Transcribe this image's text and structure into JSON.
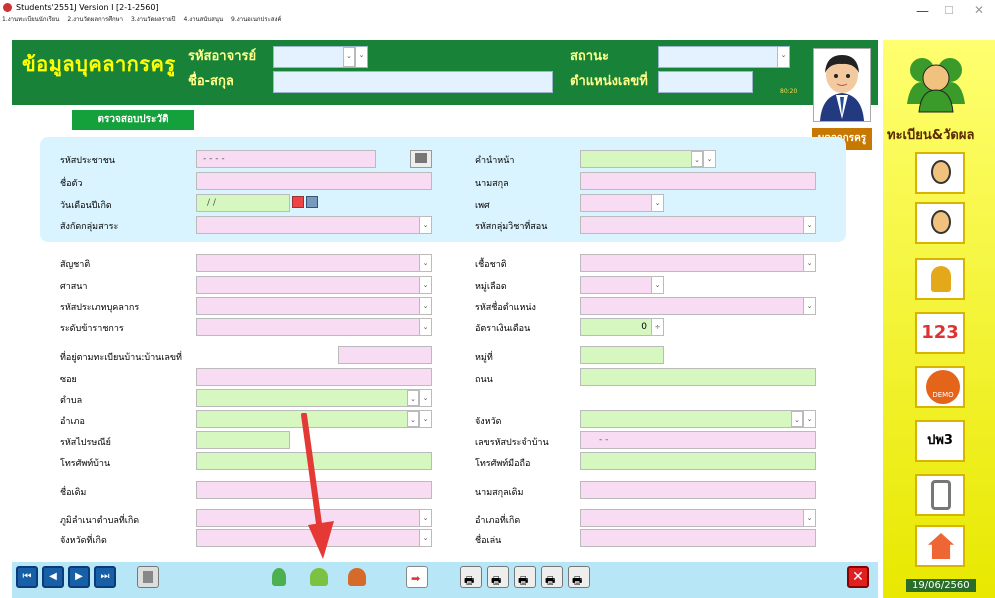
{
  "window": {
    "title": "Students'2551J Version I [2-1-2560]",
    "menu": [
      "1.งานทะเบียนนักเรียน",
      "2.งานวัดผลการศึกษา",
      "3.งานวัดผลรายปี",
      "4.งานสนับสนุน",
      "9.งานอเนกประสงค์"
    ]
  },
  "header": {
    "title": "ข้อมูลบุคลากรครู",
    "teacher_code_label": "รหัสอาจารย์",
    "name_label": "ชื่อ-สกุล",
    "status_label": "สถานะ",
    "position_no_label": "ตำแหน่งเลขที่",
    "record_no": "80:20",
    "avatar_caption": "บุคลากรครู"
  },
  "check_button": "ตรวจสอบประวัติ",
  "form": {
    "citizen_id_label": "รหัสประชาชน",
    "citizen_id_value": "-   -    -  -",
    "prefix_label": "คำนำหน้า",
    "first_name_label": "ชื่อตัว",
    "last_name_label": "นามสกุล",
    "birth_date_label": "วันเดือนปีเกิด",
    "birth_date_value": "/ /",
    "gender_label": "เพศ",
    "dept_label": "สังกัดกลุ่มสาระ",
    "subject_group_label": "รหัสกลุ่มวิชาที่สอน",
    "nationality_label": "สัญชาติ",
    "race_label": "เชื้อชาติ",
    "religion_label": "ศาสนา",
    "blood_label": "หมู่เลือด",
    "personnel_type_label": "รหัสประเภทบุคลากร",
    "position_code_label": "รหัสชื่อตำแหน่ง",
    "gov_level_label": "ระดับข้าราชการ",
    "salary_label": "อัตราเงินเดือน",
    "salary_value": "0",
    "house_no_label": "ที่อยู่ตามทะเบียนบ้าน:บ้านเลขที่",
    "moo_label": "หมู่ที่",
    "soi_label": "ซอย",
    "road_label": "ถนน",
    "tambon_label": "ตำบล",
    "amphoe_label": "อำเภอ",
    "province_label": "จังหวัด",
    "postcode_label": "รหัสไปรษณีย์",
    "house_code_label": "เลขรหัสประจำบ้าน",
    "house_code_value": "-   -",
    "phone_label": "โทรศัพท์บ้าน",
    "mobile_label": "โทรศัพท์มือถือ",
    "old_name_label": "ชื่อเดิม",
    "old_surname_label": "นามสกุลเดิม",
    "birth_tambon_label": "ภูมิลำเนาตำบลที่เกิด",
    "birth_amphoe_label": "อำเภอที่เกิด",
    "birth_province_label": "จังหวัดที่เกิด",
    "nickname_label": "ชื่อเล่น"
  },
  "sidebar": {
    "label": "ทะเบียน&วัดผล",
    "date": "19/06/2560",
    "icons": [
      "teacher-icon",
      "teacher-icon",
      "bell-icon",
      "number-123-icon",
      "demo-icon",
      "pw3-icon",
      "hourglass-icon",
      "home-icon"
    ],
    "pw3": "ปพ3",
    "num": "123",
    "demo": "DEMO"
  },
  "colors": {
    "header_green": "#178238",
    "title_yellow": "#ffff00",
    "field_pink": "#f7dcf3",
    "field_green": "#d6f7c0",
    "panel_blue": "#d9f4ff",
    "sidebar_yellow": "#ffff70",
    "toolbar_blue": "#b7e7f6",
    "annotation_arrow": "#e53935"
  }
}
